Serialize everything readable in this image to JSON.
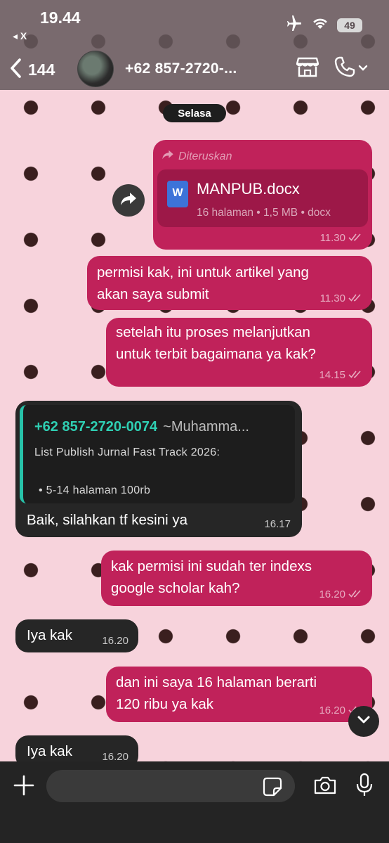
{
  "status_bar": {
    "time": "19.44",
    "back_app": "◂ X",
    "battery": "49"
  },
  "header": {
    "back_count": "144",
    "contact_name": "+62 857-2720-..."
  },
  "day_separator": "Selasa",
  "messages": [
    {
      "direction": "outgoing",
      "forwarded_label": "Diteruskan",
      "document": {
        "name": "MANPUB.docx",
        "info": "16 halaman • 1,5 MB • docx",
        "icon_letter": "W"
      },
      "time": "11.30"
    },
    {
      "direction": "outgoing",
      "lines": [
        "permisi kak, ini untuk artikel yang",
        "akan saya submit"
      ],
      "time": "11.30"
    },
    {
      "direction": "outgoing",
      "lines": [
        "setelah itu proses melanjutkan",
        "untuk terbit bagaimana ya kak?"
      ],
      "time": "14.15"
    },
    {
      "direction": "incoming",
      "quote": {
        "sender": "+62 857-2720-0074",
        "sender_alias": "~Muhamma...",
        "line1": "List Publish Jurnal Fast Track 2026:",
        "line2": "•  5-14   halaman 100rb"
      },
      "lines": [
        "Baik, silahkan tf kesini ya"
      ],
      "time": "16.17"
    },
    {
      "direction": "outgoing",
      "lines": [
        "kak permisi ini sudah ter indexs",
        "google scholar kah?"
      ],
      "time": "16.20"
    },
    {
      "direction": "incoming",
      "lines": [
        "Iya kak"
      ],
      "time": "16.20"
    },
    {
      "direction": "outgoing",
      "lines": [
        "dan ini saya 16 halaman berarti",
        "120 ribu ya kak"
      ],
      "time": "16.20"
    },
    {
      "direction": "incoming",
      "lines": [
        "Iya kak"
      ],
      "time": "16.20"
    }
  ],
  "composer": {
    "placeholder": ""
  },
  "colors": {
    "outgoing_bubble": "#c0225a",
    "incoming_bubble": "#262626",
    "wallpaper": "#f7d3dc",
    "wallpaper_dots": "#3a1f1f",
    "quote_accent": "#27c2a9"
  },
  "icons": {
    "status": [
      "airplane-icon",
      "wifi-icon",
      "battery-icon"
    ],
    "header": [
      "chevron-left-icon",
      "store-icon",
      "phone-icon",
      "chevron-down-icon"
    ],
    "chat": [
      "forward-icon",
      "read-receipt-icon",
      "chevron-down-icon"
    ],
    "composer": [
      "plus-icon",
      "sticker-icon",
      "camera-icon",
      "mic-icon"
    ]
  }
}
